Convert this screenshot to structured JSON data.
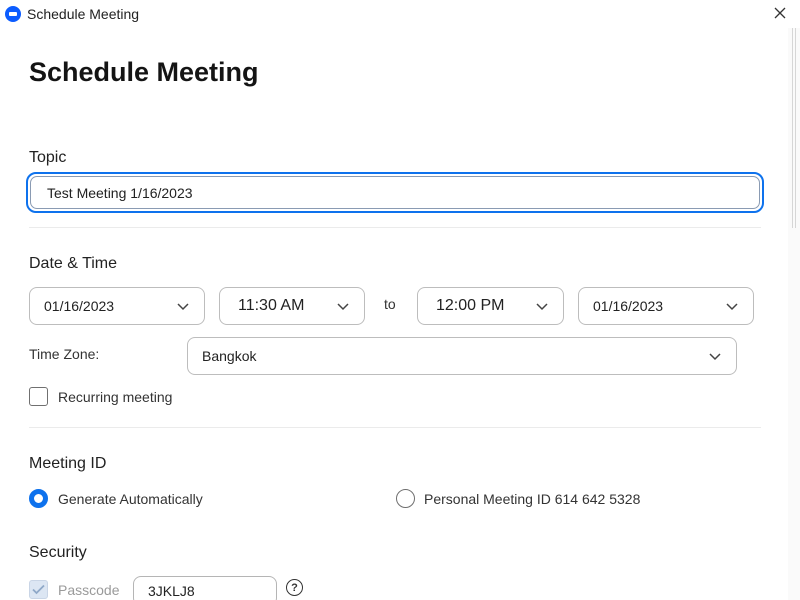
{
  "window": {
    "title": "Schedule Meeting",
    "app_icon": "zoom-app-icon",
    "close_icon": "close-icon"
  },
  "page": {
    "heading": "Schedule Meeting"
  },
  "topic": {
    "label": "Topic",
    "value": "Test Meeting 1/16/2023"
  },
  "datetime": {
    "label": "Date & Time",
    "start_date": "01/16/2023",
    "start_time": "11:30 AM",
    "to_label": "to",
    "end_time": "12:00 PM",
    "end_date": "01/16/2023",
    "timezone_label": "Time Zone:",
    "timezone": "Bangkok",
    "recurring_label": "Recurring meeting",
    "recurring_checked": false
  },
  "meeting_id": {
    "label": "Meeting ID",
    "options": [
      {
        "label": "Generate Automatically",
        "selected": true
      },
      {
        "label": "Personal Meeting ID 614 642 5328",
        "selected": false
      }
    ]
  },
  "security": {
    "label": "Security",
    "passcode_label": "Passcode",
    "passcode_checked": true,
    "passcode_value": "3JKLJ8",
    "help_glyph": "?"
  },
  "colors": {
    "accent": "#0e72ed",
    "brand": "#0b5cff",
    "border": "#bdbdbd",
    "disabled": "#9a9a9a"
  }
}
